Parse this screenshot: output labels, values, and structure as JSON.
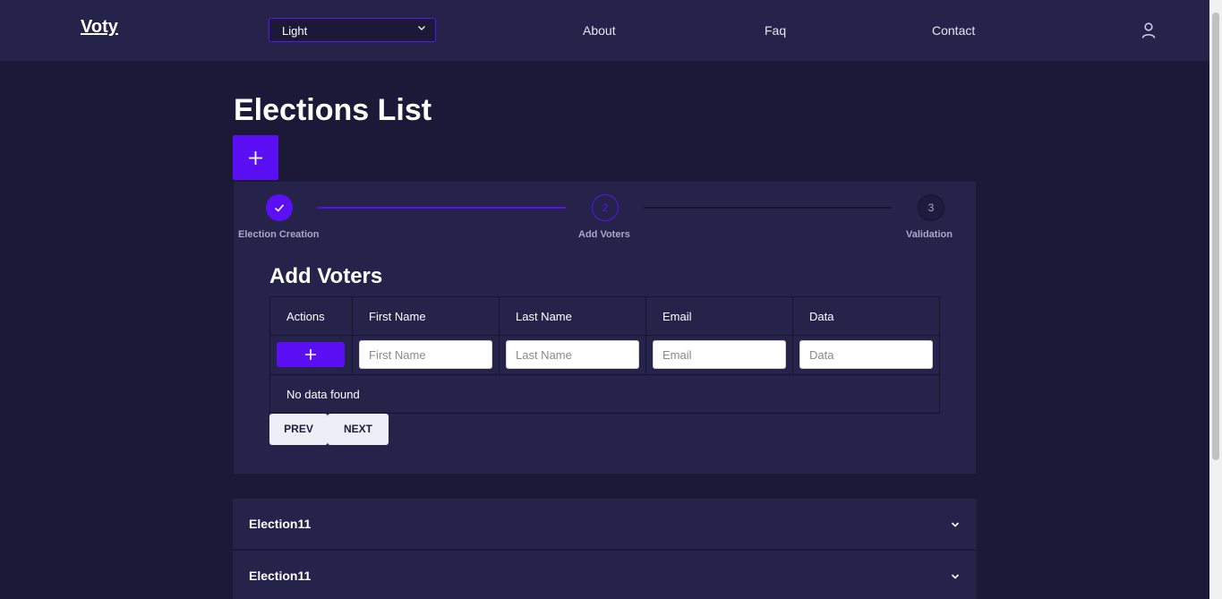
{
  "navbar": {
    "brand": "Voty",
    "theme_select": {
      "value": "Light"
    },
    "links": [
      "About",
      "Faq",
      "Contact"
    ]
  },
  "page": {
    "title": "Elections List"
  },
  "stepper": {
    "steps": [
      {
        "label": "Election Creation",
        "status": "completed"
      },
      {
        "label": "Add Voters",
        "number": "2",
        "status": "active"
      },
      {
        "label": "Validation",
        "number": "3",
        "status": "pending"
      }
    ]
  },
  "voters": {
    "title": "Add Voters",
    "columns": [
      "Actions",
      "First Name",
      "Last Name",
      "Email",
      "Data"
    ],
    "placeholders": {
      "first_name": "First Name",
      "last_name": "Last Name",
      "email": "Email",
      "data": "Data"
    },
    "empty_message": "No data found",
    "prev_label": "PREV",
    "next_label": "NEXT"
  },
  "elections": [
    {
      "name": "Election11"
    },
    {
      "name": "Election11"
    }
  ],
  "colors": {
    "accent": "#5b0ff5",
    "background": "#1b1838",
    "surface": "#25234a"
  }
}
